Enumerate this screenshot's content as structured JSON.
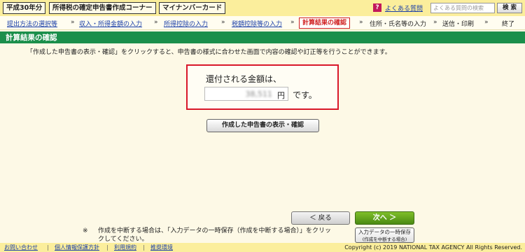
{
  "header": {
    "year_badge": "平成30年分",
    "corner_title": "所得税の確定申告書作成コーナー",
    "mynumber_card": "マイナンバーカード",
    "help_icon_glyph": "?",
    "faq_link": "よくある質問",
    "faq_search_placeholder": "よくある質問の検索",
    "search_button": "検 索"
  },
  "steps": {
    "items": [
      {
        "label": "提出方法の選択等"
      },
      {
        "label": "収入・所得金額の入力"
      },
      {
        "label": "所得控除の入力"
      },
      {
        "label": "税額控除等の入力"
      },
      {
        "label": "計算結果の確認"
      },
      {
        "label": "住所・氏名等の入力"
      },
      {
        "label": "送信・印刷"
      },
      {
        "label": "終了"
      }
    ],
    "arrow": "»",
    "current_index": 4
  },
  "section": {
    "title": "計算結果の確認",
    "instruction": "「作成した申告書の表示・確認」をクリックすると、申告書の様式に合わせた画面で内容の確認や訂正等を行うことができます。"
  },
  "refund": {
    "label": "還付される金額は、",
    "amount": "38,511",
    "unit": "円",
    "suffix": "です。"
  },
  "buttons": {
    "show_return": "作成した申告書の表示・確認",
    "back": "＜ 戻る",
    "next": "次へ ＞",
    "save_line1": "入力データの一時保存",
    "save_line2": "(作成を中断する場合)"
  },
  "note": {
    "mark": "※",
    "text": "作成を中断する場合は、「入力データの一時保存（作成を中断する場合）」をクリックしてください。"
  },
  "footer": {
    "links": [
      "お問い合わせ",
      "個人情報保護方針",
      "利用規約",
      "推奨環境"
    ],
    "separator": "|",
    "copyright": "Copyright (c) 2019 NATIONAL TAX AGENCY All Rights Reserved."
  },
  "colors": {
    "title_bar": "#1b8f4b",
    "header_bg": "#fbee9c",
    "current_step": "#d02020",
    "refund_border": "#d9182a",
    "next_button": "#5a9a1a",
    "link": "#1b3fa8"
  }
}
